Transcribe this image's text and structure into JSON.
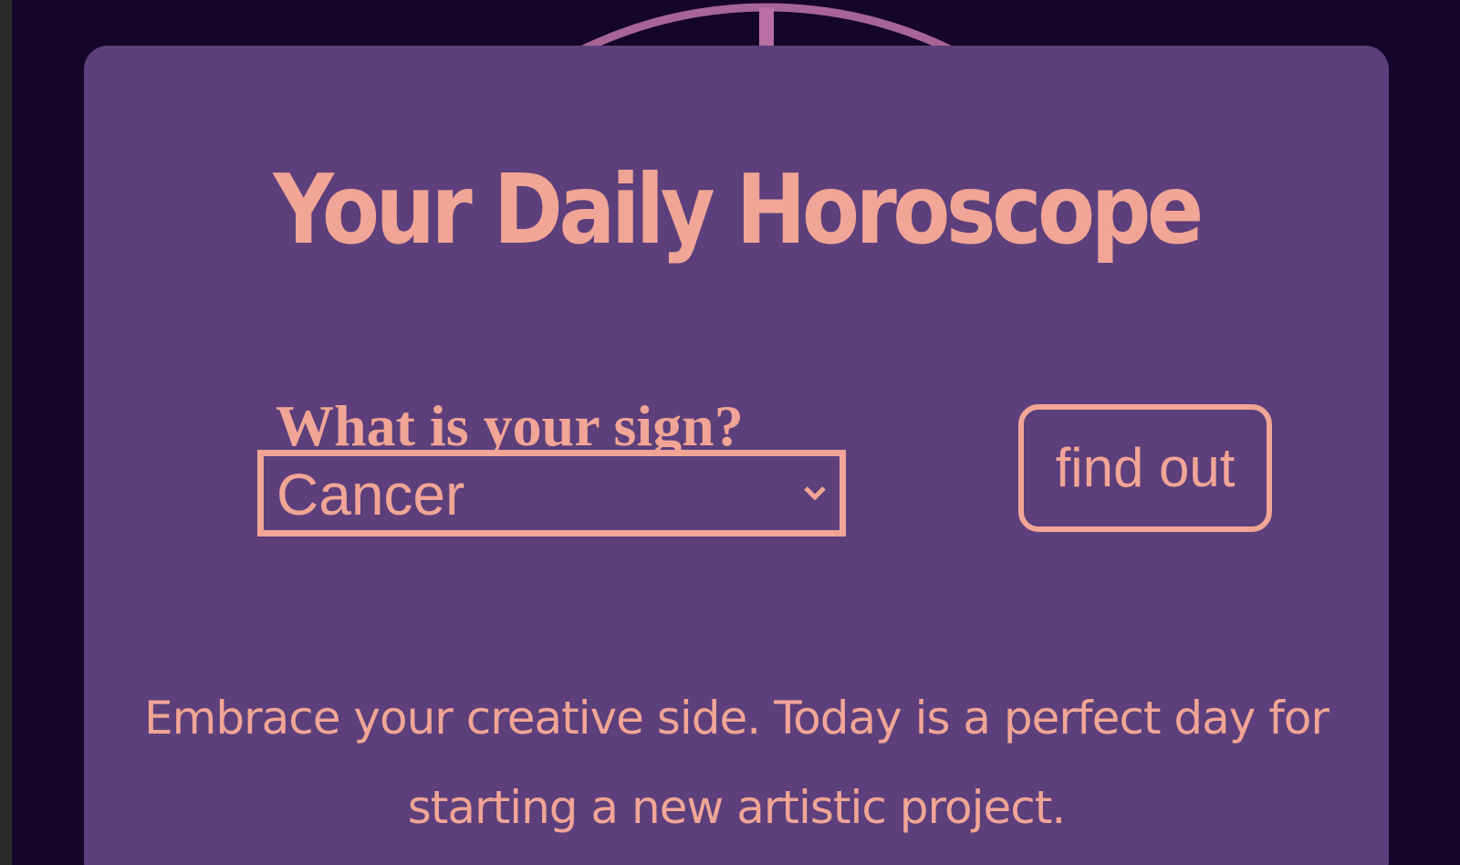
{
  "page": {
    "title": "Your Daily Horoscope",
    "question": "What is your sign?",
    "selected_sign": "Cancer",
    "button_label": "find out",
    "horoscope_text": "Embrace your creative side. Today is a perfect day for starting a new artistic project."
  },
  "colors": {
    "background": "#14052a",
    "card": "#5c3f7b",
    "accent": "#f1a596",
    "wheel": "#b86fa3"
  },
  "icons": {
    "select_arrow": "chevron-down-icon"
  }
}
